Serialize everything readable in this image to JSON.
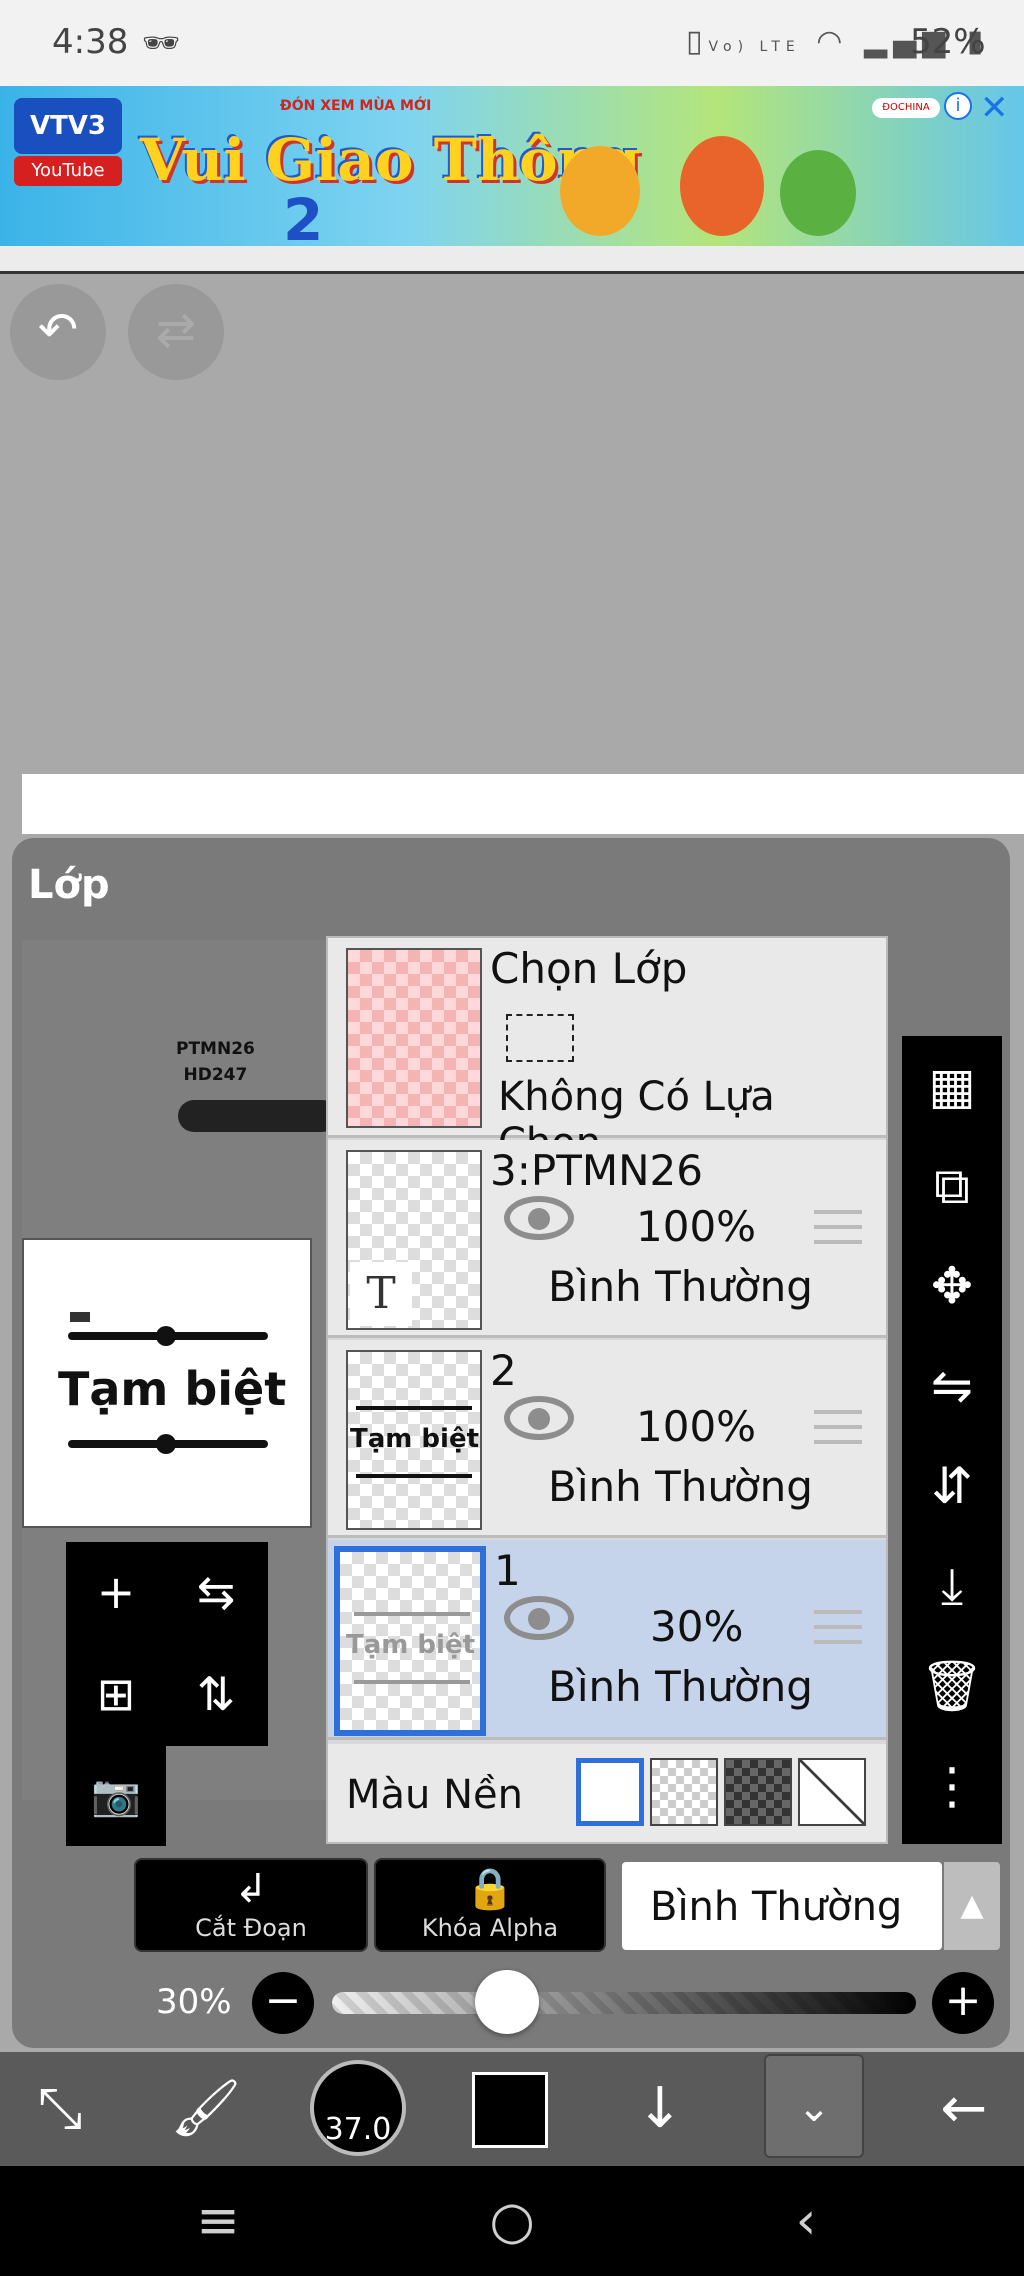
{
  "status_bar": {
    "time": "4:38",
    "battery": "52%",
    "net_label": "Vo) LTE"
  },
  "ad": {
    "channel": "VTV3",
    "platform": "YouTube",
    "tagline": "ĐÓN XEM MÙA MỚI",
    "title": "Vui Giao Thông",
    "number": "2",
    "brand": "ĐOCHINA"
  },
  "canvas": {
    "text_line1": "PTMN26",
    "text_line2": "HD247"
  },
  "panel": {
    "title": "Lớp",
    "preview_text": "Tạm biệt"
  },
  "layers": {
    "selection": {
      "name": "Chọn Lớp",
      "status": "Không Có Lựa Chọn"
    },
    "items": [
      {
        "name": "3:PTMN26",
        "opacity": "100%",
        "blend": "Bình Thường",
        "thumb_text": "T"
      },
      {
        "name": "2",
        "opacity": "100%",
        "blend": "Bình Thường",
        "thumb_text": "Tạm biệt"
      },
      {
        "name": "1",
        "opacity": "30%",
        "blend": "Bình Thường",
        "thumb_text": "Tạm biệt"
      }
    ],
    "background_label": "Màu Nền"
  },
  "controls": {
    "clip_label": "Cắt Đoạn",
    "alpha_lock_label": "Khóa Alpha",
    "blend_mode": "Bình Thường",
    "opacity_label": "30%",
    "opacity_value": 0.3
  },
  "toolbar": {
    "brush_size": "37.0"
  },
  "colors": {
    "selected_layer_bg": "#c5d4ea",
    "selected_border": "#2f6fdc",
    "current_color": "#000000"
  }
}
